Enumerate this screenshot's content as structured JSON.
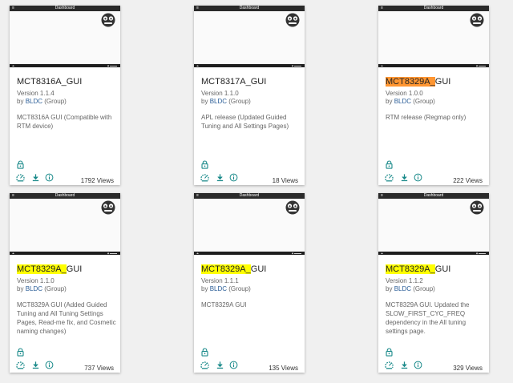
{
  "colors": {
    "teal": "#1a8a8a",
    "highlight_yellow": "#ffff00",
    "highlight_orange": "#ff9632",
    "link_blue": "#2a5d97"
  },
  "thumbnail": {
    "header_title": "Dashboard",
    "menu_glyph": "≡"
  },
  "owner_prefix": "by",
  "owner_link": "BLDC",
  "owner_suffix": "(Group)",
  "icons": [
    "lock-icon",
    "gauge-launch-icon",
    "download-icon",
    "info-icon"
  ],
  "cards": [
    {
      "title_highlight": "",
      "title_rest": "MCT8316A_GUI",
      "highlight": "none",
      "version": "Version 1.1.4",
      "description": "MCT8316A GUI (Compatible with RTM device)",
      "views": "1792 Views"
    },
    {
      "title_highlight": "",
      "title_rest": "MCT8317A_GUI",
      "highlight": "none",
      "version": "Version 1.1.0",
      "description": "APL release (Updated Guided Tuning and All Settings Pages)",
      "views": "18 Views"
    },
    {
      "title_highlight": "MCT8329A_",
      "title_rest": "GUI",
      "highlight": "orange",
      "version": "Version 1.0.0",
      "description": "RTM release (Regmap only)",
      "views": "222 Views"
    },
    {
      "title_highlight": "MCT8329A_",
      "title_rest": "GUI",
      "highlight": "yellow",
      "version": "Version 1.1.0",
      "description": "MCT8329A GUI (Added Guided Tuning and All Tuning Settings Pages, Read-me fix, and Cosmetic naming changes)",
      "views": "737 Views"
    },
    {
      "title_highlight": "MCT8329A_",
      "title_rest": "GUI",
      "highlight": "yellow",
      "version": "Version 1.1.1",
      "description": "MCT8329A GUI",
      "views": "135 Views"
    },
    {
      "title_highlight": "MCT8329A_",
      "title_rest": "GUI",
      "highlight": "yellow",
      "version": "Version 1.1.2",
      "description": "MCT8329A GUI. Updated the SLOW_FIRST_CYC_FREQ dependency in the All tuning settings page.",
      "views": "329 Views"
    }
  ]
}
